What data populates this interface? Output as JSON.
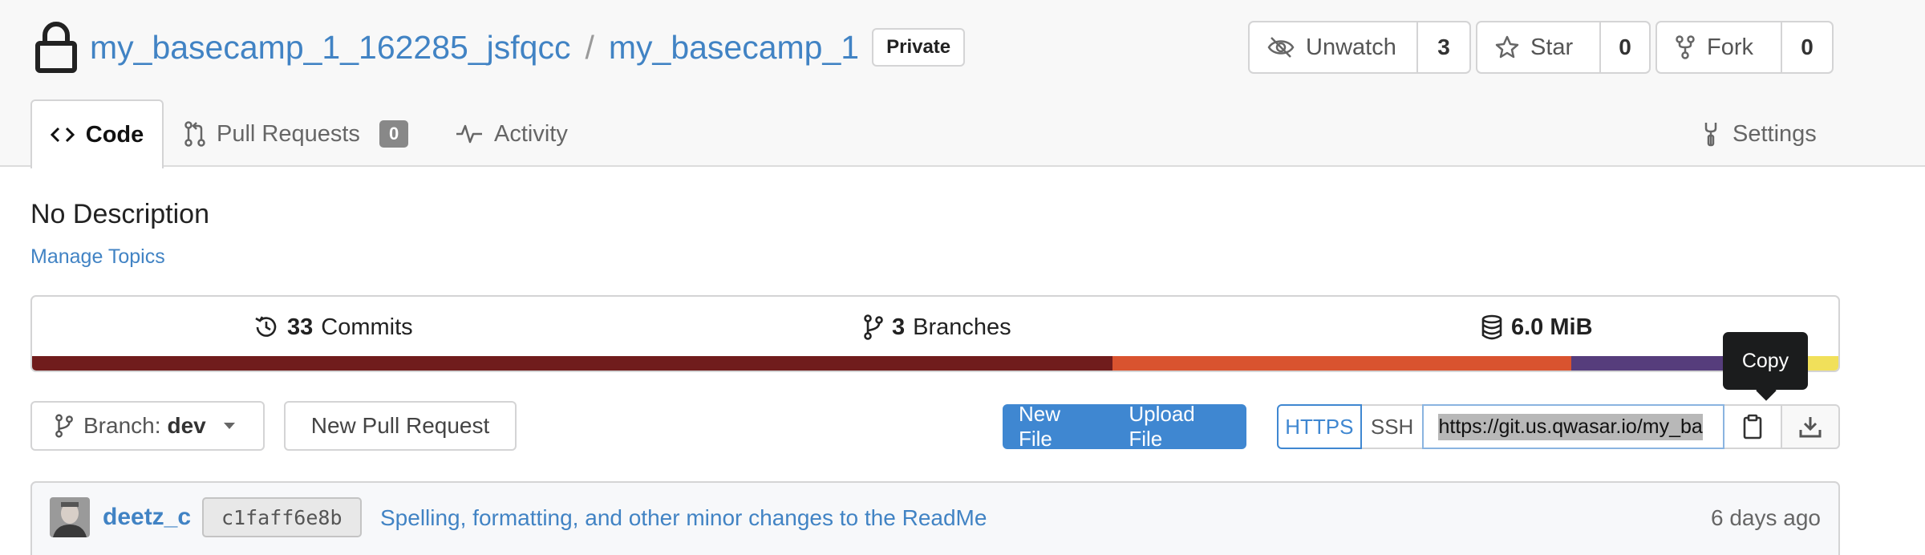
{
  "repo": {
    "owner": "my_basecamp_1_162285_jsfqcc",
    "separator": "/",
    "name": "my_basecamp_1",
    "visibility": "Private"
  },
  "actions": {
    "watch": {
      "label": "Unwatch",
      "count": "3"
    },
    "star": {
      "label": "Star",
      "count": "0"
    },
    "fork": {
      "label": "Fork",
      "count": "0"
    }
  },
  "tabs": {
    "code": "Code",
    "pulls": "Pull Requests",
    "pulls_count": "0",
    "activity": "Activity",
    "settings": "Settings"
  },
  "description": "No Description",
  "manage_topics": "Manage Topics",
  "stats": {
    "commits_count": "33",
    "commits_label": "Commits",
    "branches_count": "3",
    "branches_label": "Branches",
    "size": "6.0 MiB"
  },
  "language_bar": [
    {
      "color": "#701c1c",
      "fraction": 0.598
    },
    {
      "color": "#d9532f",
      "fraction": 0.254
    },
    {
      "color": "#563d7c",
      "fraction": 0.128
    },
    {
      "color": "#f1e05a",
      "fraction": 0.02
    }
  ],
  "tooltip": "Copy",
  "toolbar": {
    "branch_prefix": "Branch:",
    "branch_name": "dev",
    "new_pull_request": "New Pull Request",
    "new_file": "New File",
    "upload_file": "Upload File",
    "https": "HTTPS",
    "ssh": "SSH",
    "clone_url": "https://git.us.qwasar.io/my_ba"
  },
  "latest_commit": {
    "author": "deetz_c",
    "sha": "c1faff6e8b",
    "message": "Spelling, formatting, and other minor changes to the ReadMe",
    "time": "6 days ago"
  },
  "icons": {
    "lock": "lock-icon",
    "unwatch": "eye-slash-icon",
    "star": "star-icon",
    "fork": "fork-icon",
    "code": "code-icon",
    "pull_request": "pull-request-icon",
    "activity": "pulse-icon",
    "settings": "tools-icon",
    "commits": "history-icon",
    "branches": "branch-icon",
    "size": "database-icon",
    "copy": "clipboard-icon",
    "download": "download-icon"
  }
}
